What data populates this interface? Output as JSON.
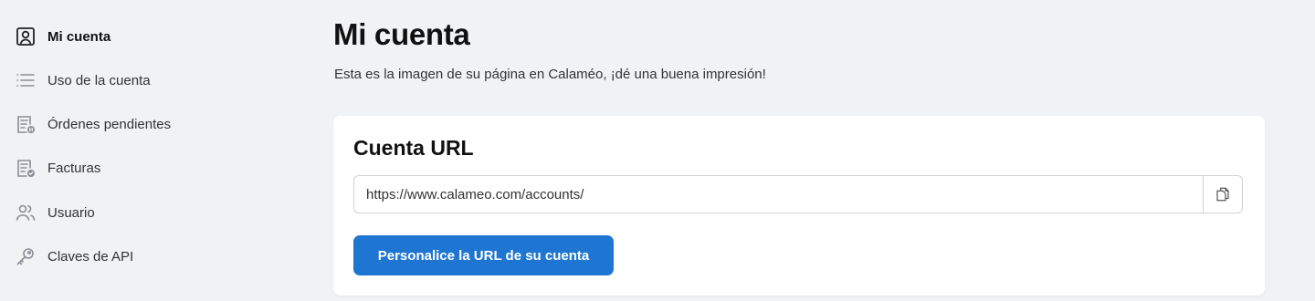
{
  "sidebar": {
    "items": [
      {
        "label": "Mi cuenta",
        "icon": "user-square-icon",
        "active": true
      },
      {
        "label": "Uso de la cuenta",
        "icon": "list-icon",
        "active": false
      },
      {
        "label": "Órdenes pendientes",
        "icon": "pending-document-icon",
        "active": false
      },
      {
        "label": "Facturas",
        "icon": "invoice-check-icon",
        "active": false
      },
      {
        "label": "Usuario",
        "icon": "users-icon",
        "active": false
      },
      {
        "label": "Claves de API",
        "icon": "key-icon",
        "active": false
      }
    ]
  },
  "main": {
    "title": "Mi cuenta",
    "subtitle": "Esta es la imagen de su página en Calaméo, ¡dé una buena impresión!",
    "card": {
      "title": "Cuenta URL",
      "url_value": "https://www.calameo.com/accounts/",
      "copy_icon": "copy-icon",
      "button_label": "Personalice la URL de su cuenta"
    }
  },
  "colors": {
    "background": "#f1f2f4",
    "accent": "#1f76d2",
    "card": "#ffffff"
  }
}
